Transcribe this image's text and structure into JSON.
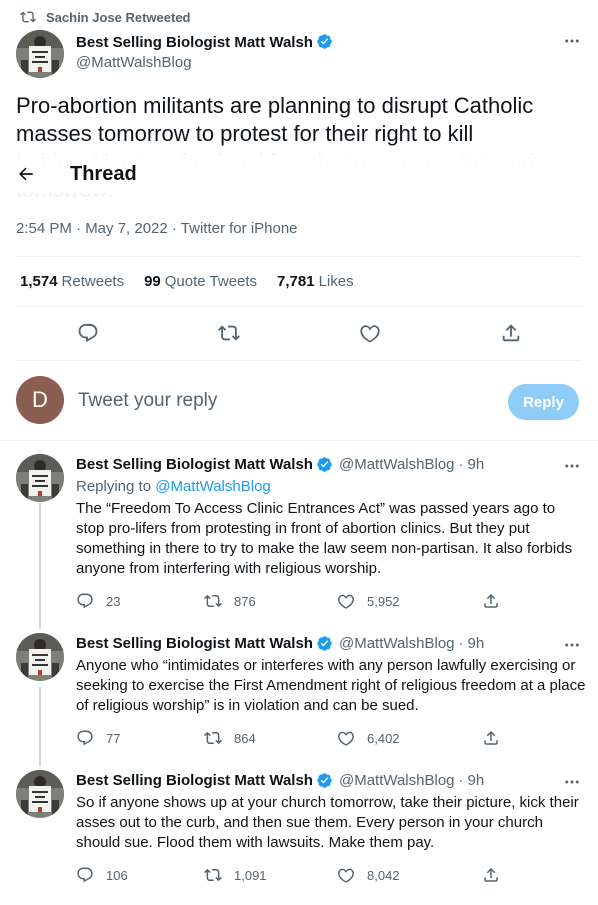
{
  "retweet_context": {
    "label": "Sachin Jose Retweeted"
  },
  "main_tweet": {
    "author_name": "Best Selling Biologist Matt Walsh",
    "handle": "@MattWalshBlog",
    "text_line1": "Pro-abortion militants are planning to disrupt Catholic",
    "text_line2": "masses tomorrow to protest for their right to kill",
    "text_faded": "babies. Here's a fun legal fact that may come in handy tomorrow:",
    "timestamp": "2:54 PM · May 7, 2022 · Twitter for iPhone",
    "retweets_count": "1,574",
    "retweets_label": "Retweets",
    "quotes_count": "99",
    "quotes_label": "Quote Tweets",
    "likes_count": "7,781",
    "likes_label": "Likes"
  },
  "thread_header": {
    "title": "Thread"
  },
  "reply_composer": {
    "avatar_letter": "D",
    "placeholder": "Tweet your reply",
    "button_label": "Reply"
  },
  "replies": [
    {
      "author_name": "Best Selling Biologist Matt Walsh",
      "handle": "@MattWalshBlog",
      "time": "9h",
      "replying_prefix": "Replying to",
      "replying_handle": "@MattWalshBlog",
      "text": "The “Freedom To Access Clinic Entrances Act” was passed years ago to stop pro-lifers from protesting in front of abortion clinics. But they put something in there to try to make the law seem non-partisan. It also forbids anyone from interfering with religious worship.",
      "replies_count": "23",
      "retweets_count": "876",
      "likes_count": "5,952"
    },
    {
      "author_name": "Best Selling Biologist Matt Walsh",
      "handle": "@MattWalshBlog",
      "time": "9h",
      "text": "Anyone who “intimidates or interferes with any person lawfully exercising or seeking to exercise the First Amendment right of religious freedom at a place of religious worship” is in violation and can be sued.",
      "replies_count": "77",
      "retweets_count": "864",
      "likes_count": "6,402"
    },
    {
      "author_name": "Best Selling Biologist Matt Walsh",
      "handle": "@MattWalshBlog",
      "time": "9h",
      "text": "So if anyone shows up at your church tomorrow, take their picture, kick their asses out to the curb, and then sue them. Every person in your church should sue. Flood them with lawsuits. Make them pay.",
      "replies_count": "106",
      "retweets_count": "1,091",
      "likes_count": "8,042"
    }
  ],
  "colors": {
    "accent": "#1d9bf0",
    "reply_button_disabled": "#8ecdf8",
    "muted_text": "#536471",
    "divider": "#eff3f4"
  },
  "icons": [
    "retweet-icon",
    "verified-badge-icon",
    "more-icon",
    "back-arrow-icon",
    "reply-icon",
    "like-icon",
    "share-icon"
  ]
}
